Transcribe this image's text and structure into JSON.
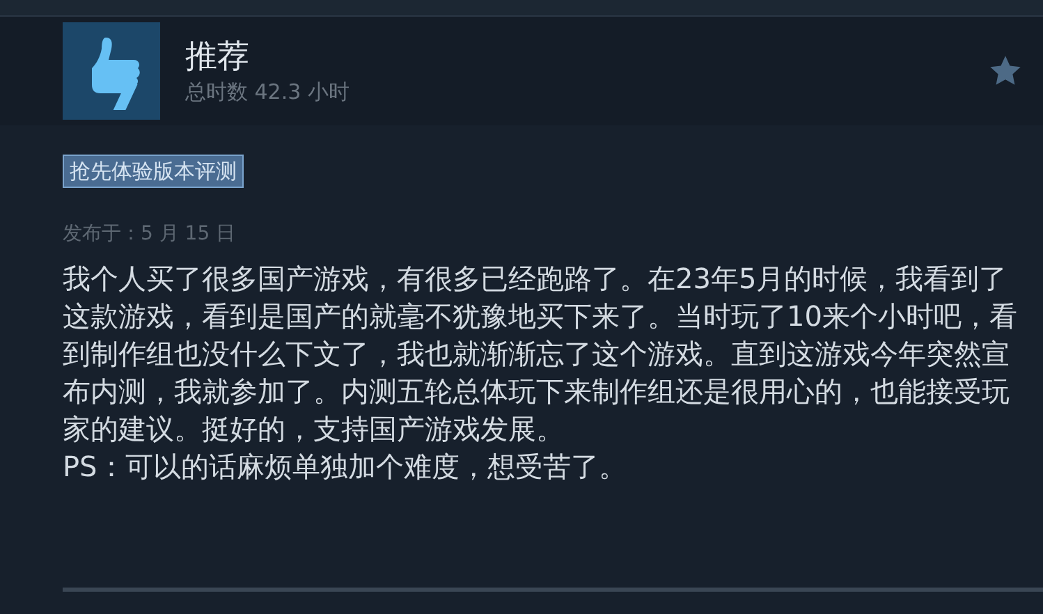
{
  "review": {
    "verdict": "推荐",
    "playtime": "总时数 42.3 小时",
    "badge": "抢先体验版本评测",
    "posted": "发布于：5 月 15 日",
    "paragraphs": [
      "我个人买了很多国产游戏，有很多已经跑路了。在23年5月的时候，我看到了这款游戏，看到是国产的就毫不犹豫地买下来了。当时玩了10来个小时吧，看到制作组也没什么下文了，我也就渐渐忘了这个游戏。直到这游戏今年突然宣布内测，我就参加了。内测五轮总体玩下来制作组还是很用心的，也能接受玩家的建议。挺好的，支持国产游戏发展。",
      "PS：可以的话麻烦单独加个难度，想受苦了。"
    ]
  }
}
